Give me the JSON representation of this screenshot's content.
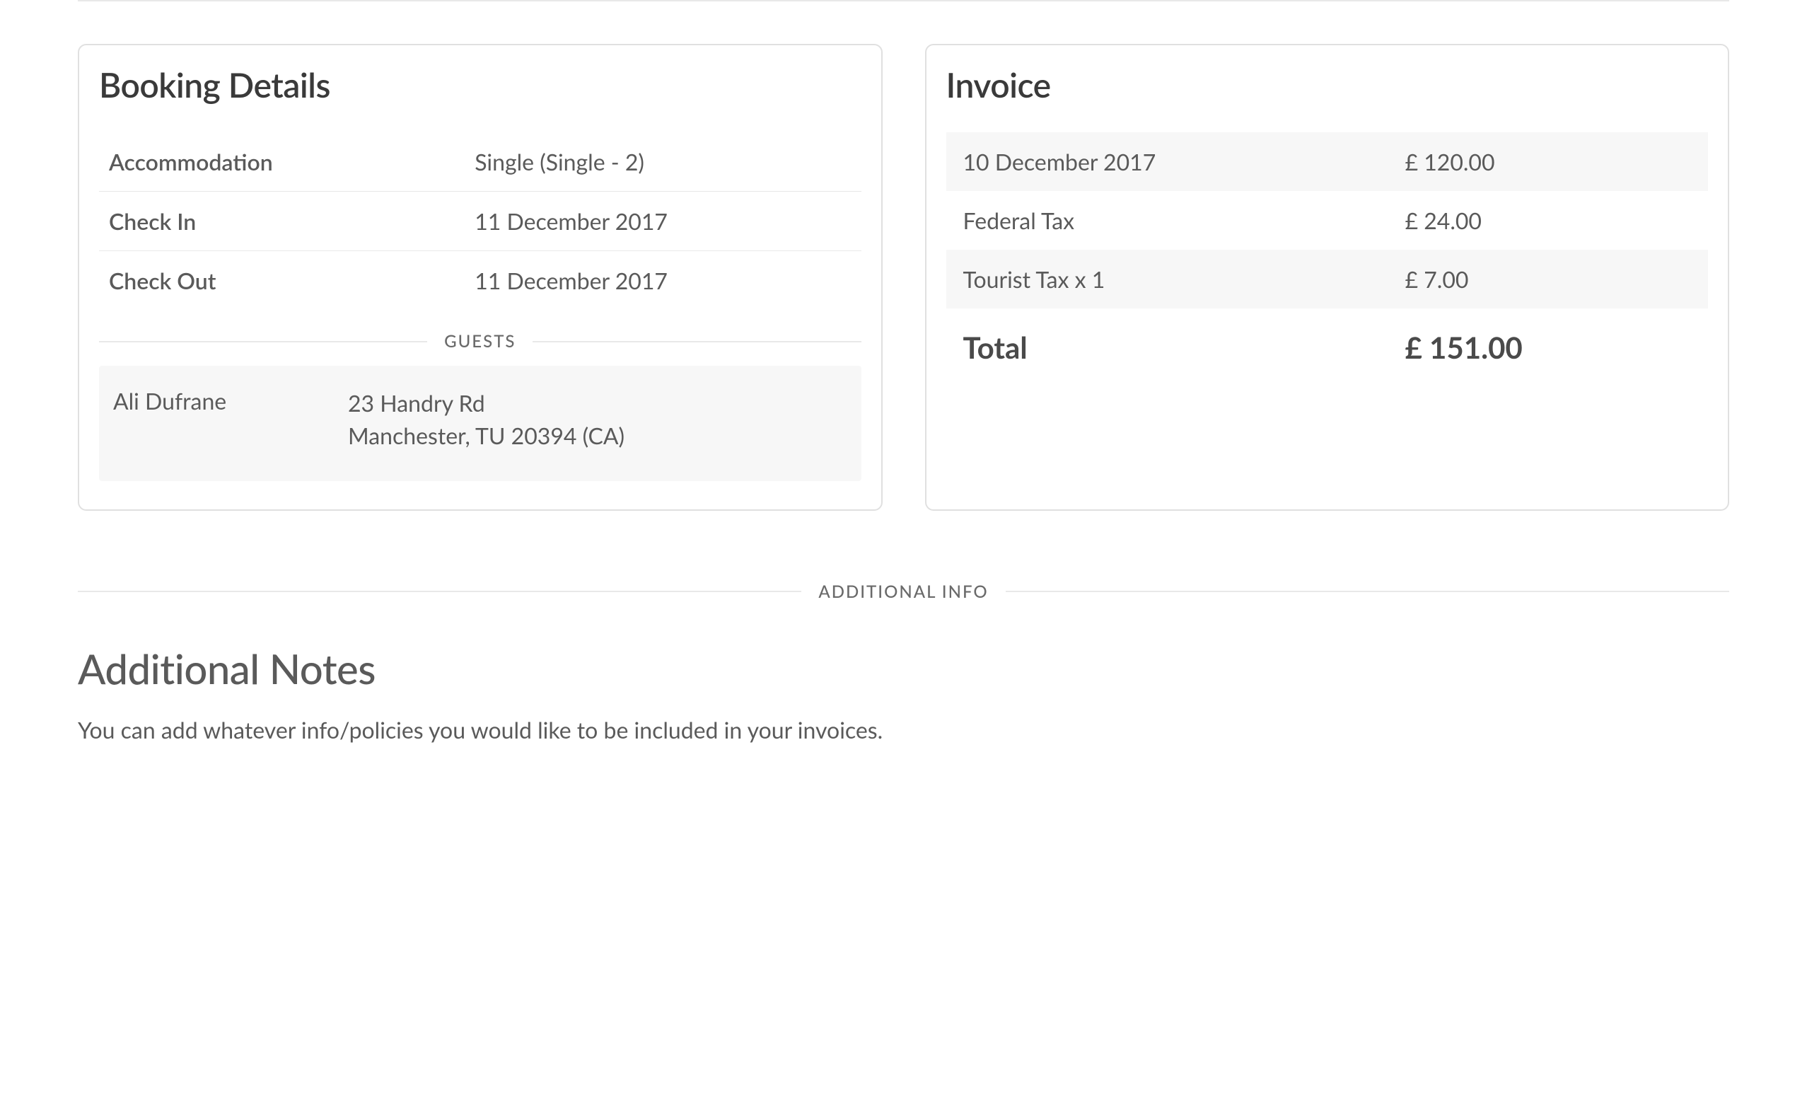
{
  "booking": {
    "title": "Booking Details",
    "rows": [
      {
        "label": "Accommodation",
        "value": "Single (Single - 2)"
      },
      {
        "label": "Check In",
        "value": "11 December 2017"
      },
      {
        "label": "Check Out",
        "value": "11 December 2017"
      }
    ],
    "guests_label": "GUESTS",
    "guest": {
      "name": "Ali Dufrane",
      "address_line1": "23 Handry Rd",
      "address_line2": "Manchester, TU 20394 (CA)"
    }
  },
  "invoice": {
    "title": "Invoice",
    "lines": [
      {
        "desc": "10 December 2017",
        "amount": "£ 120.00"
      },
      {
        "desc": "Federal Tax",
        "amount": "£ 24.00"
      },
      {
        "desc": "Tourist Tax x 1",
        "amount": "£ 7.00"
      }
    ],
    "total_label": "Total",
    "total_amount": "£ 151.00"
  },
  "additional": {
    "divider_label": "ADDITIONAL INFO",
    "heading": "Additional Notes",
    "text": "You can add whatever info/policies you would like to be included in your invoices."
  }
}
